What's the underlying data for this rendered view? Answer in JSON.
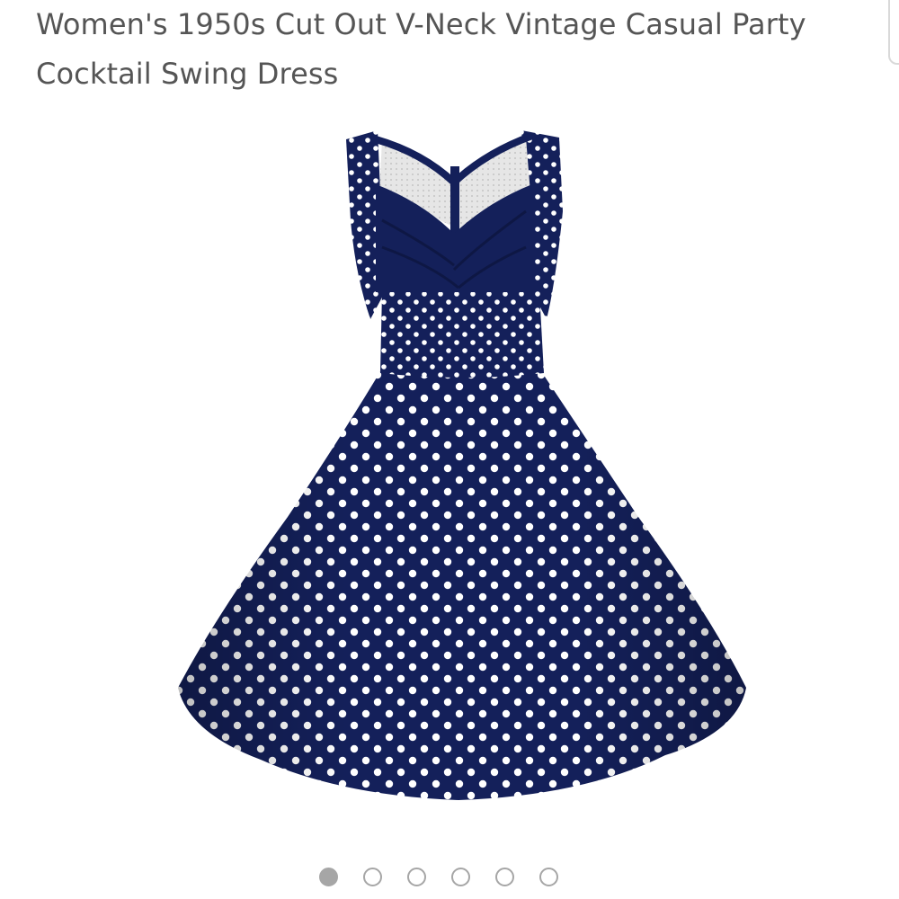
{
  "product": {
    "title": "Women's 1950s Cut Out V-Neck Vintage Casual Party Cocktail Swing Dress",
    "image": {
      "subject": "polka-dot-swing-dress",
      "colors": {
        "fabric": "#14205a",
        "fabric_shadow": "#0d1644",
        "dots": "#ffffff",
        "mesh": "#dcdcdc"
      }
    }
  },
  "carousel": {
    "total": 6,
    "active_index": 0,
    "dot_color": "#a6a6a6"
  }
}
